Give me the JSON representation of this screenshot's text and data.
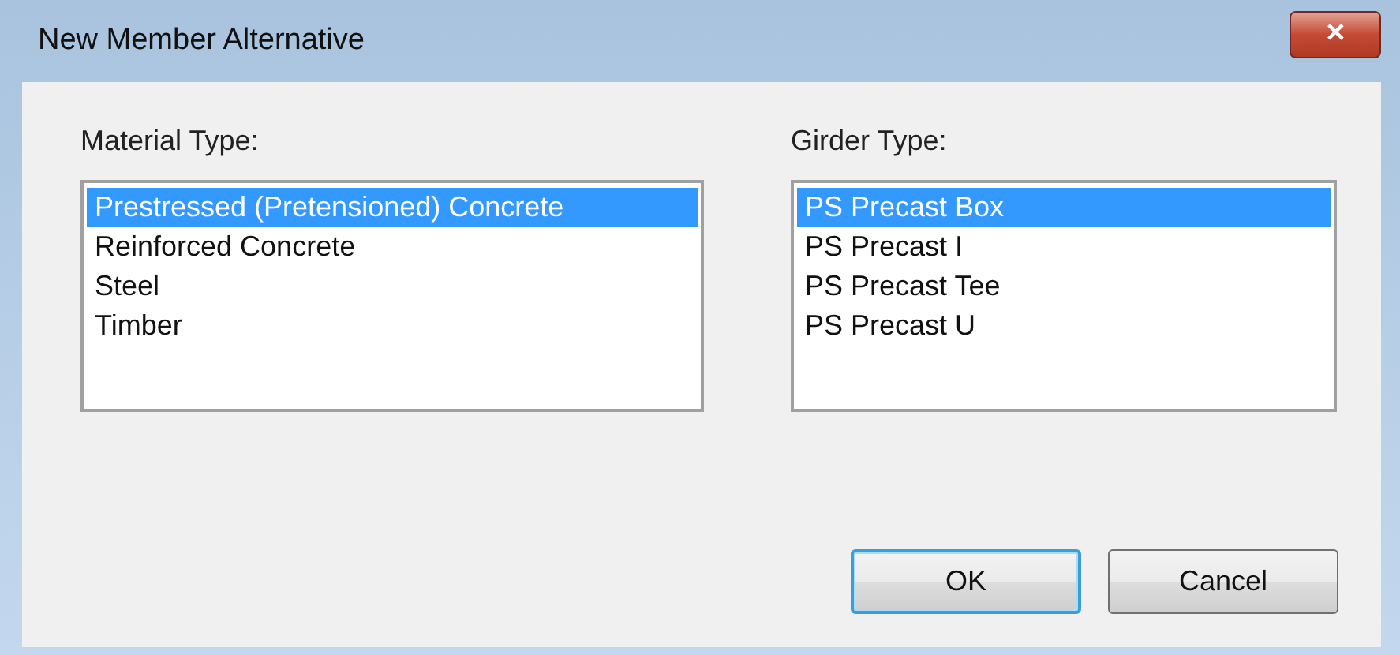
{
  "window": {
    "title": "New Member Alternative",
    "close": "✕"
  },
  "lists": [
    {
      "label": "Material Type:",
      "items": [
        {
          "text": "Prestressed (Pretensioned) Concrete",
          "selected": true
        },
        {
          "text": "Reinforced Concrete",
          "selected": false
        },
        {
          "text": "Steel",
          "selected": false
        },
        {
          "text": "Timber",
          "selected": false
        }
      ]
    },
    {
      "label": "Girder Type:",
      "items": [
        {
          "text": "PS Precast Box",
          "selected": true
        },
        {
          "text": "PS Precast I",
          "selected": false
        },
        {
          "text": "PS Precast Tee",
          "selected": false
        },
        {
          "text": "PS Precast U",
          "selected": false
        }
      ]
    }
  ],
  "buttons": [
    {
      "label": "OK",
      "default": true
    },
    {
      "label": "Cancel",
      "default": false
    }
  ]
}
